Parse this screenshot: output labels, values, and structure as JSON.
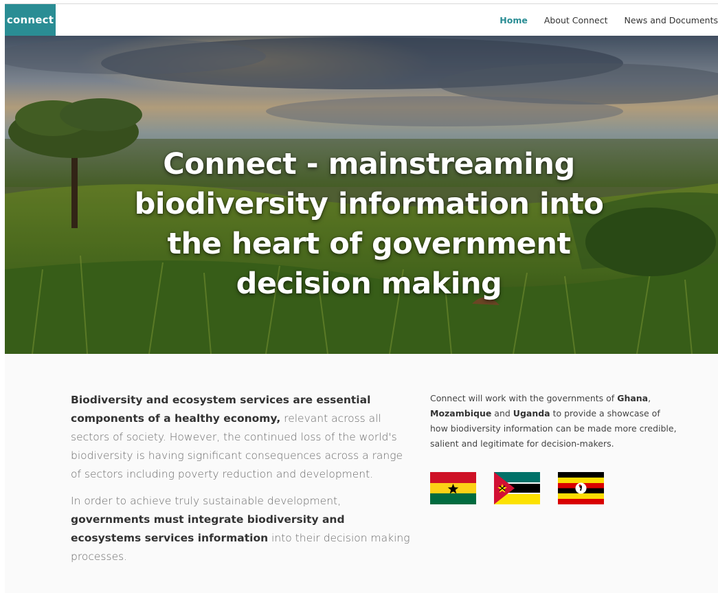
{
  "brand": {
    "label": "connect",
    "color": "#2a8d94"
  },
  "nav": {
    "items": [
      {
        "label": "Home",
        "active": true
      },
      {
        "label": "About Connect",
        "active": false
      },
      {
        "label": "News and Documents",
        "active": false
      }
    ]
  },
  "hero": {
    "title": "Connect - mainstreaming biodiversity information into the heart of government decision making"
  },
  "intro": {
    "p1_bold": "Biodiversity and ecosystem services are essential components of a healthy economy,",
    "p1_rest": " relevant across all sectors of society. However, the continued loss of the world's biodiversity is having significant consequences across a range of sectors including poverty reduction and development.",
    "p2_start": "In order to achieve truly sustainable development, ",
    "p2_bold": "governments must integrate biodiversity and ecosystems services information",
    "p2_end": " into their decision making processes."
  },
  "countries": {
    "text_start": "Connect will work with the governments of ",
    "ghana": "Ghana",
    "sep1": ",",
    "mozambique": "Mozambique",
    "and": " and ",
    "uganda": "Uganda",
    "text_end": " to provide a showcase of how biodiversity information can be made more credible, salient and legitimate for decision-makers.",
    "flags": [
      "ghana-flag",
      "mozambique-flag",
      "uganda-flag"
    ]
  }
}
